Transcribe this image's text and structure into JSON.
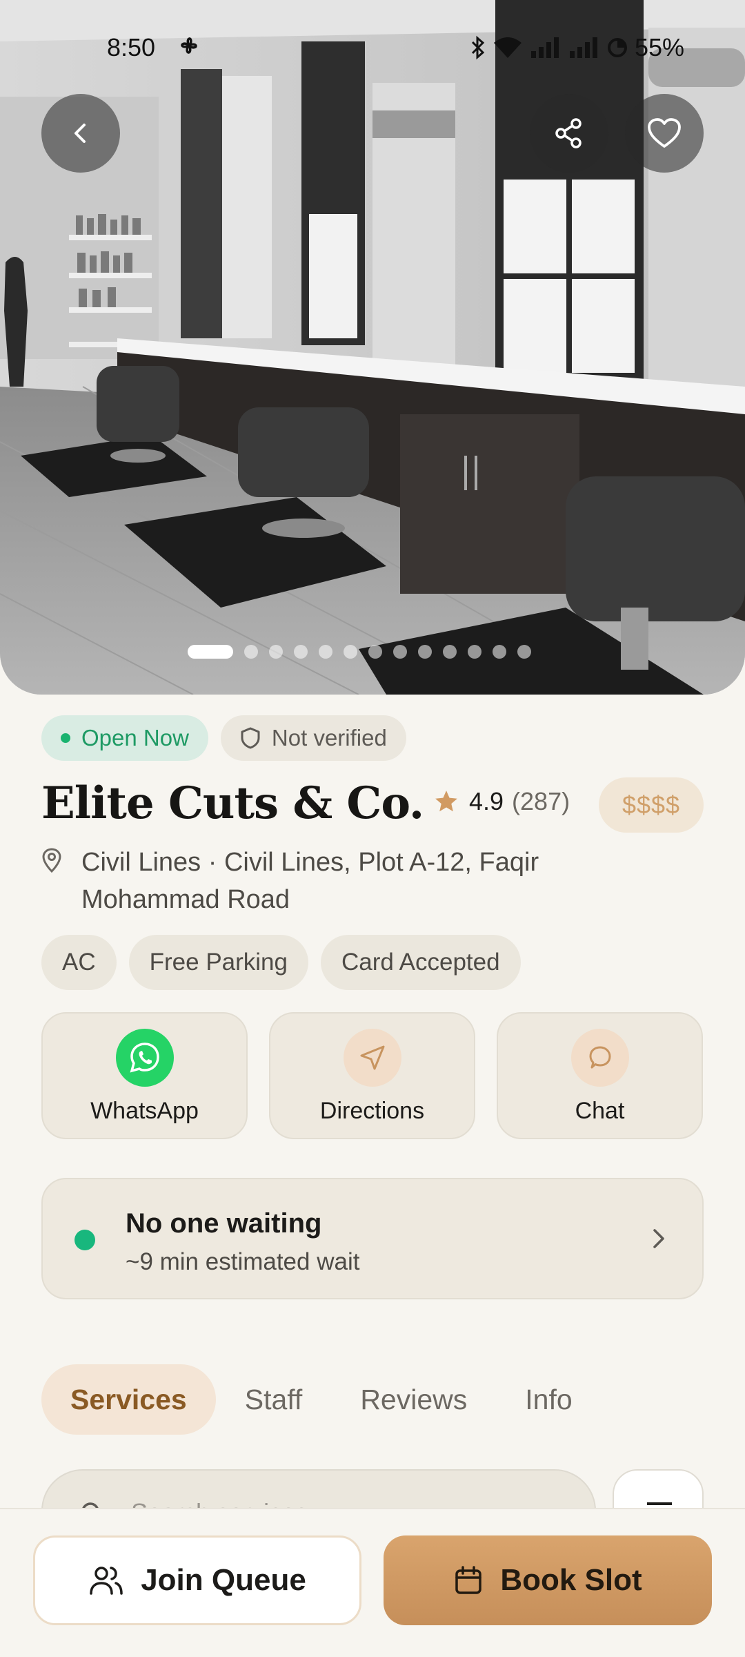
{
  "status_bar": {
    "time": "8:50",
    "battery": "55%"
  },
  "hero": {
    "slide_count": 13,
    "active_slide": 0
  },
  "status_badges": {
    "open": "Open Now",
    "verified": "Not verified"
  },
  "salon": {
    "name": "Elite Cuts & Co.",
    "rating": "4.9",
    "review_count": "(287)",
    "price_level": "$$$$",
    "address": "Civil Lines · Civil Lines, Plot A-12, Faqir Mohammad Road"
  },
  "amenities": [
    "AC",
    "Free Parking",
    "Card Accepted"
  ],
  "actions": {
    "whatsapp": "WhatsApp",
    "directions": "Directions",
    "chat": "Chat"
  },
  "queue": {
    "title": "No one waiting",
    "subtitle": "~9 min estimated wait"
  },
  "tabs": [
    "Services",
    "Staff",
    "Reviews",
    "Info"
  ],
  "search": {
    "placeholder": "Search services"
  },
  "bottom_actions": {
    "join": "Join Queue",
    "book": "Book Slot"
  },
  "colors": {
    "accent": "#c8945f",
    "open_green": "#19b36f",
    "whatsapp": "#25d366"
  }
}
